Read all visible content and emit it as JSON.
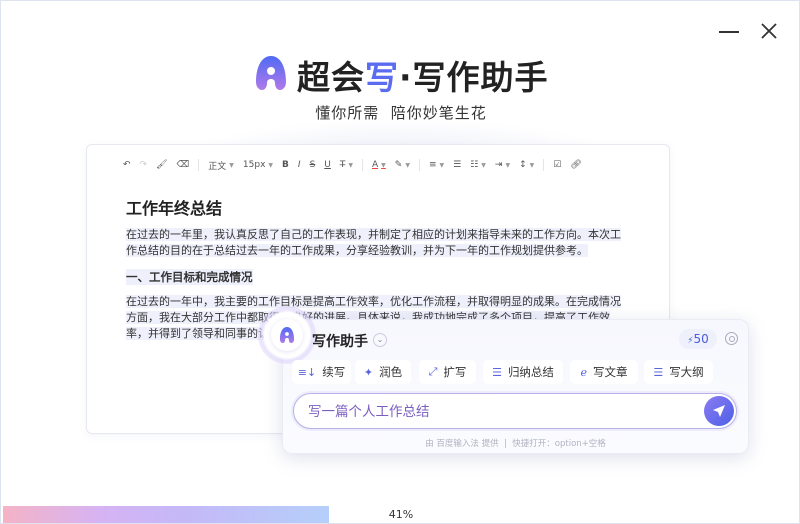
{
  "window": {
    "minimize_label": "minimize",
    "close_label": "close"
  },
  "header": {
    "brand_part1": "超会",
    "brand_part2": "写",
    "brand_part3": "·写作助手",
    "subtitle": "懂你所需  陪你妙笔生花"
  },
  "toolbar": {
    "paragraph_style": "正文",
    "font_size": "15px"
  },
  "document": {
    "title": "工作年终总结",
    "para1": "在过去的一年里，我认真反思了自己的工作表现，并制定了相应的计划来指导未来的工作方向。本次工作总结的目的在于总结过去一年的工作成果，分享经验教训，并为下一年的工作规划提供参考。",
    "heading1": "一、工作目标和完成情况",
    "para2": "在过去的一年中，我主要的工作目标是提高工作效率，优化工作流程，并取得明显的成果。在完成情况方面，我在大部分工作中都取得了良好的进展。具体来说，我成功地完成了多个项目，提高了工作效率，并得到了领导和同事的认可。"
  },
  "assistant": {
    "title": "写作助手",
    "credits": "50",
    "actions": [
      {
        "label": "续写",
        "icon": "≡↓"
      },
      {
        "label": "润色",
        "icon": "✦"
      },
      {
        "label": "扩写",
        "icon": "⤢"
      },
      {
        "label": "归纳总结",
        "icon": "☰"
      },
      {
        "label": "写文章",
        "icon": "ℯ"
      },
      {
        "label": "写大纲",
        "icon": "☰"
      }
    ],
    "input_value": "写一篇个人工作总结",
    "footer": "由 百度输入法 提供  |  快捷打开：option+空格"
  },
  "progress": {
    "value": 41,
    "label": "41%"
  },
  "colors": {
    "accent": "#5b6cf0",
    "send": "#5b5fe8"
  }
}
